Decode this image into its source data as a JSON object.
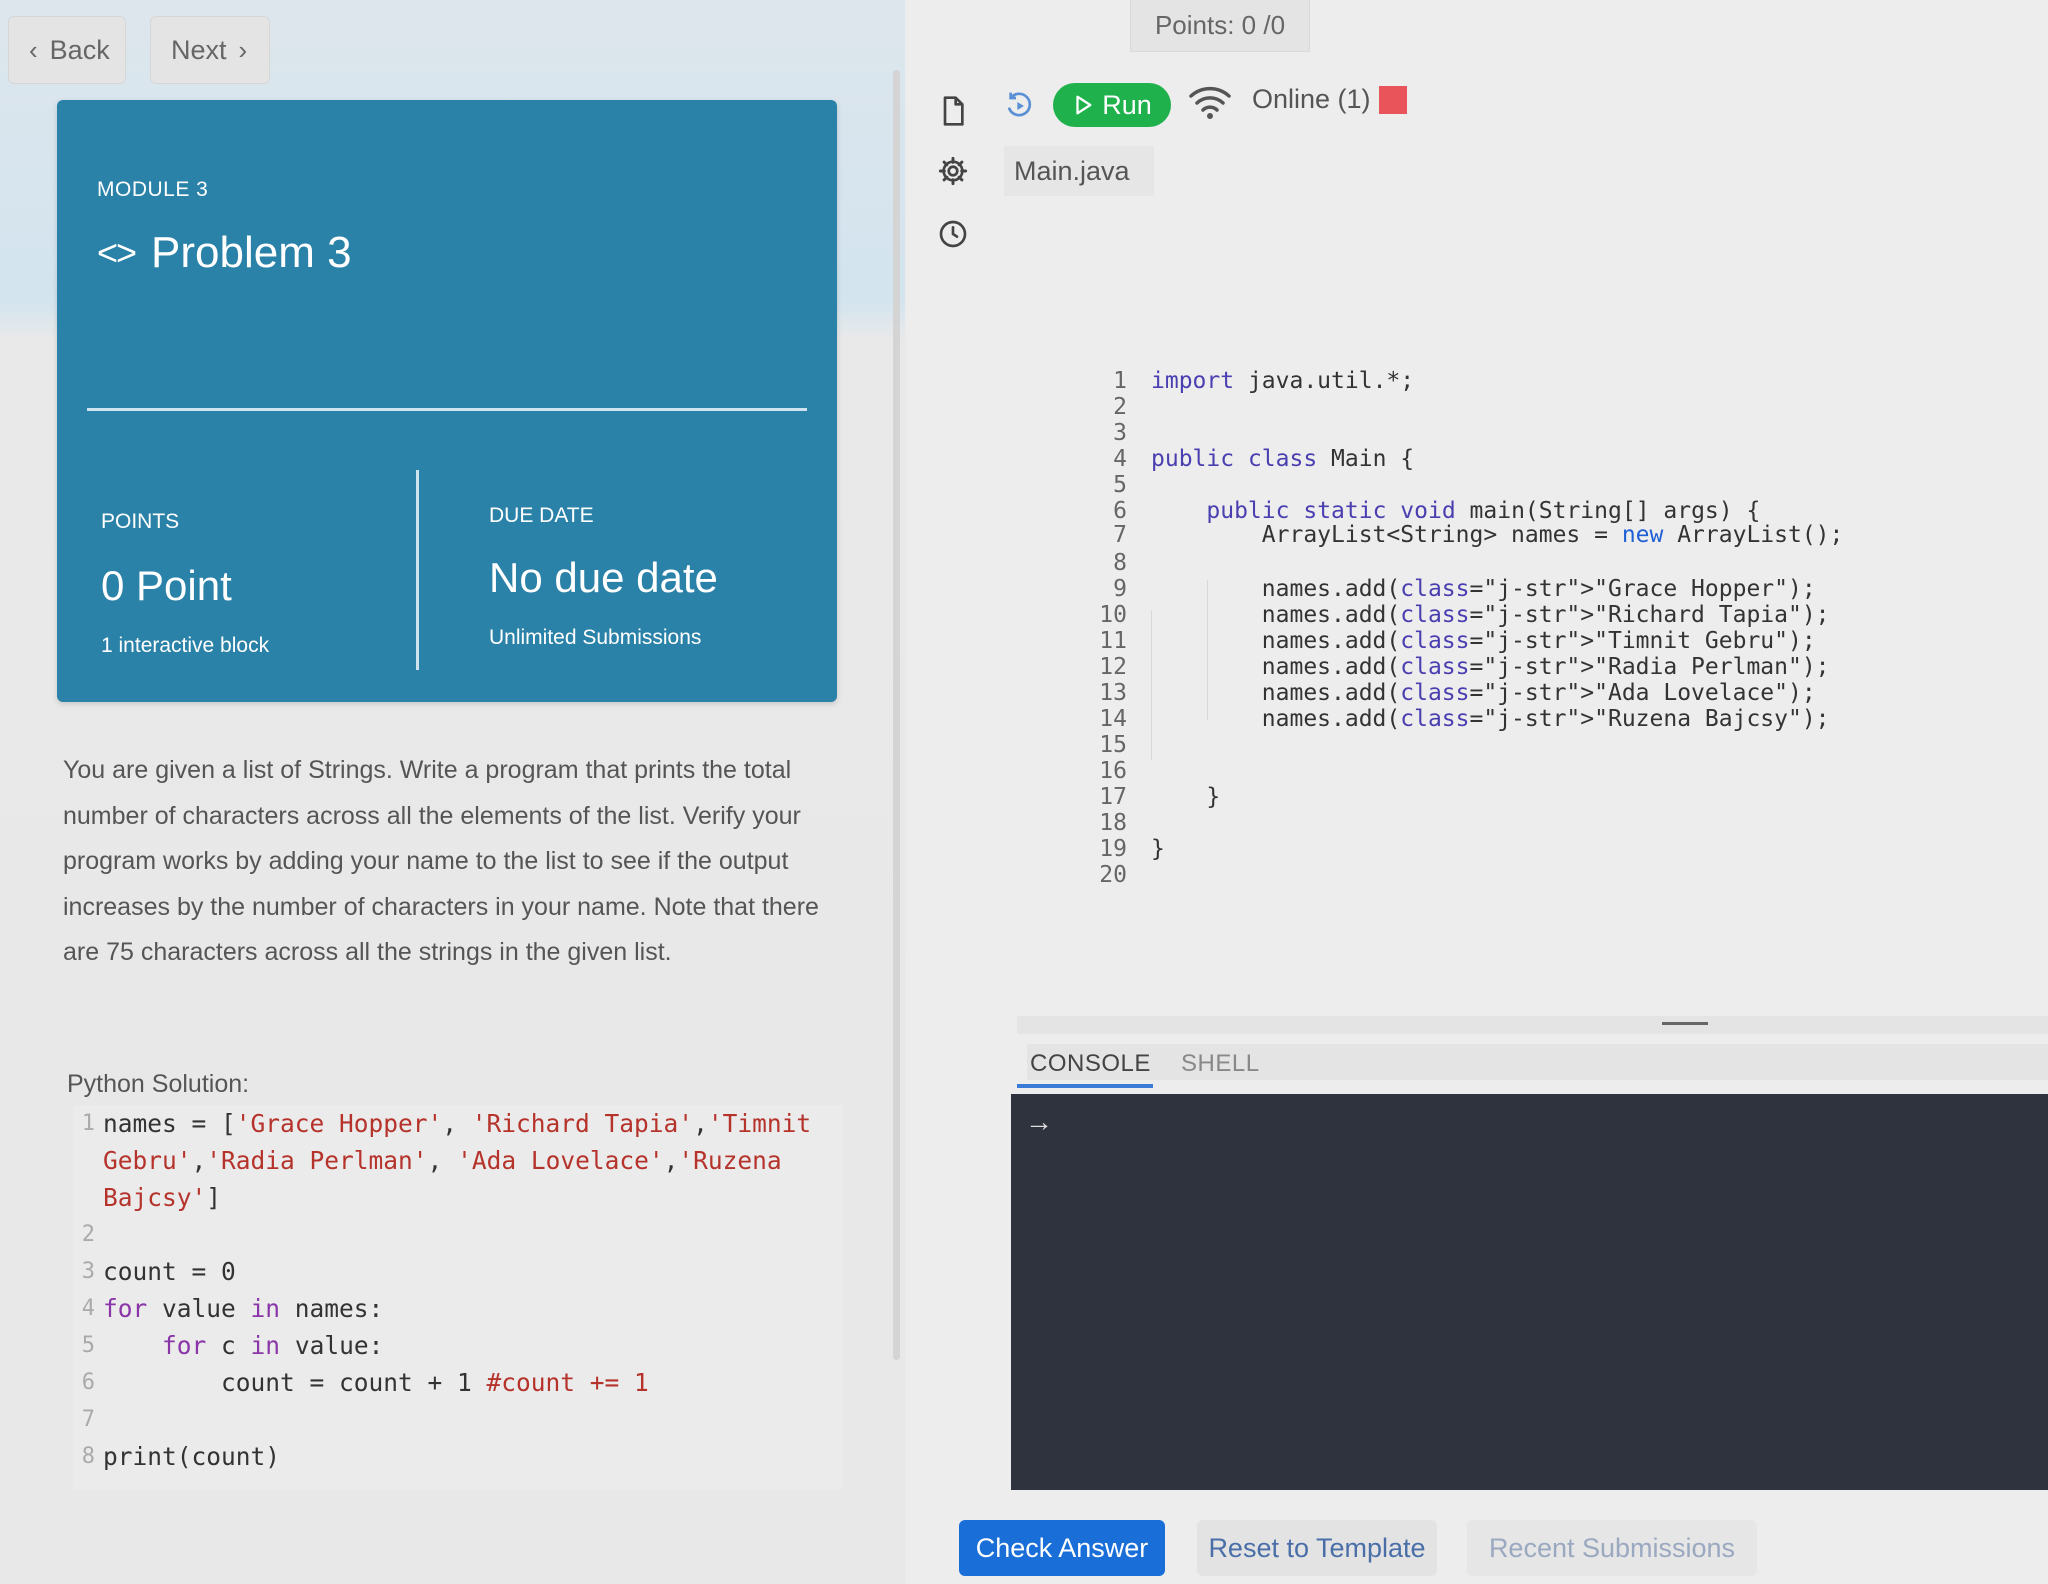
{
  "nav": {
    "back_label": "Back",
    "next_label": "Next"
  },
  "module": {
    "label": "MODULE 3",
    "title": "Problem 3",
    "points_label": "POINTS",
    "points_value": "0 Point",
    "points_sub": "1 interactive block",
    "due_label": "DUE DATE",
    "due_value": "No due date",
    "due_sub": "Unlimited Submissions"
  },
  "description": "You are given a list of Strings. Write a program that prints the total number of characters across all the elements of the list. Verify your program works by adding your name to the list to see if the output increases by the number of characters in your name. Note that there are 75 characters across all the strings in the given list.",
  "solution": {
    "label": "Python Solution:",
    "lines": [
      {
        "n": "1",
        "text": "names = ['Grace Hopper', 'Richard Tapia','Timnit Gebru','Radia Perlman', 'Ada Lovelace','Ruzena Bajcsy']"
      },
      {
        "n": "2",
        "text": ""
      },
      {
        "n": "3",
        "text": "count = 0"
      },
      {
        "n": "4",
        "text": "for value in names:"
      },
      {
        "n": "5",
        "text": "    for c in value:"
      },
      {
        "n": "6",
        "text": "        count = count + 1 #count += 1"
      },
      {
        "n": "7",
        "text": ""
      },
      {
        "n": "8",
        "text": "print(count)"
      }
    ]
  },
  "header": {
    "points": "Points: 0 /0",
    "run_label": "Run",
    "online": "Online (1)",
    "status_color": "#e8545a",
    "run_color": "#1fb14c"
  },
  "editor": {
    "filename": "Main.java",
    "lines": [
      {
        "n": "1",
        "text": "import java.util.*;"
      },
      {
        "n": "2",
        "text": ""
      },
      {
        "n": "3",
        "text": ""
      },
      {
        "n": "4",
        "text": "public class Main {"
      },
      {
        "n": "5",
        "text": ""
      },
      {
        "n": "6",
        "text": "    public static void main(String[] args) {"
      },
      {
        "n": "7",
        "text": "        ArrayList<String> names = new ArrayList();"
      },
      {
        "n": "8",
        "text": ""
      },
      {
        "n": "9",
        "text": "        names.add(\"Grace Hopper\");"
      },
      {
        "n": "10",
        "text": "        names.add(\"Richard Tapia\");"
      },
      {
        "n": "11",
        "text": "        names.add(\"Timnit Gebru\");"
      },
      {
        "n": "12",
        "text": "        names.add(\"Radia Perlman\");"
      },
      {
        "n": "13",
        "text": "        names.add(\"Ada Lovelace\");"
      },
      {
        "n": "14",
        "text": "        names.add(\"Ruzena Bajcsy\");"
      },
      {
        "n": "15",
        "text": ""
      },
      {
        "n": "16",
        "text": ""
      },
      {
        "n": "17",
        "text": "    }"
      },
      {
        "n": "18",
        "text": ""
      },
      {
        "n": "19",
        "text": "}"
      },
      {
        "n": "20",
        "text": ""
      }
    ]
  },
  "console": {
    "tab_console": "CONSOLE",
    "tab_shell": "SHELL",
    "prompt": "→"
  },
  "actions": {
    "check": "Check Answer",
    "reset": "Reset to Template",
    "recent": "Recent Submissions"
  },
  "icons": [
    "file-icon",
    "undo-icon",
    "settings-icon",
    "history-icon",
    "play-icon",
    "wifi-icon",
    "code-icon"
  ]
}
